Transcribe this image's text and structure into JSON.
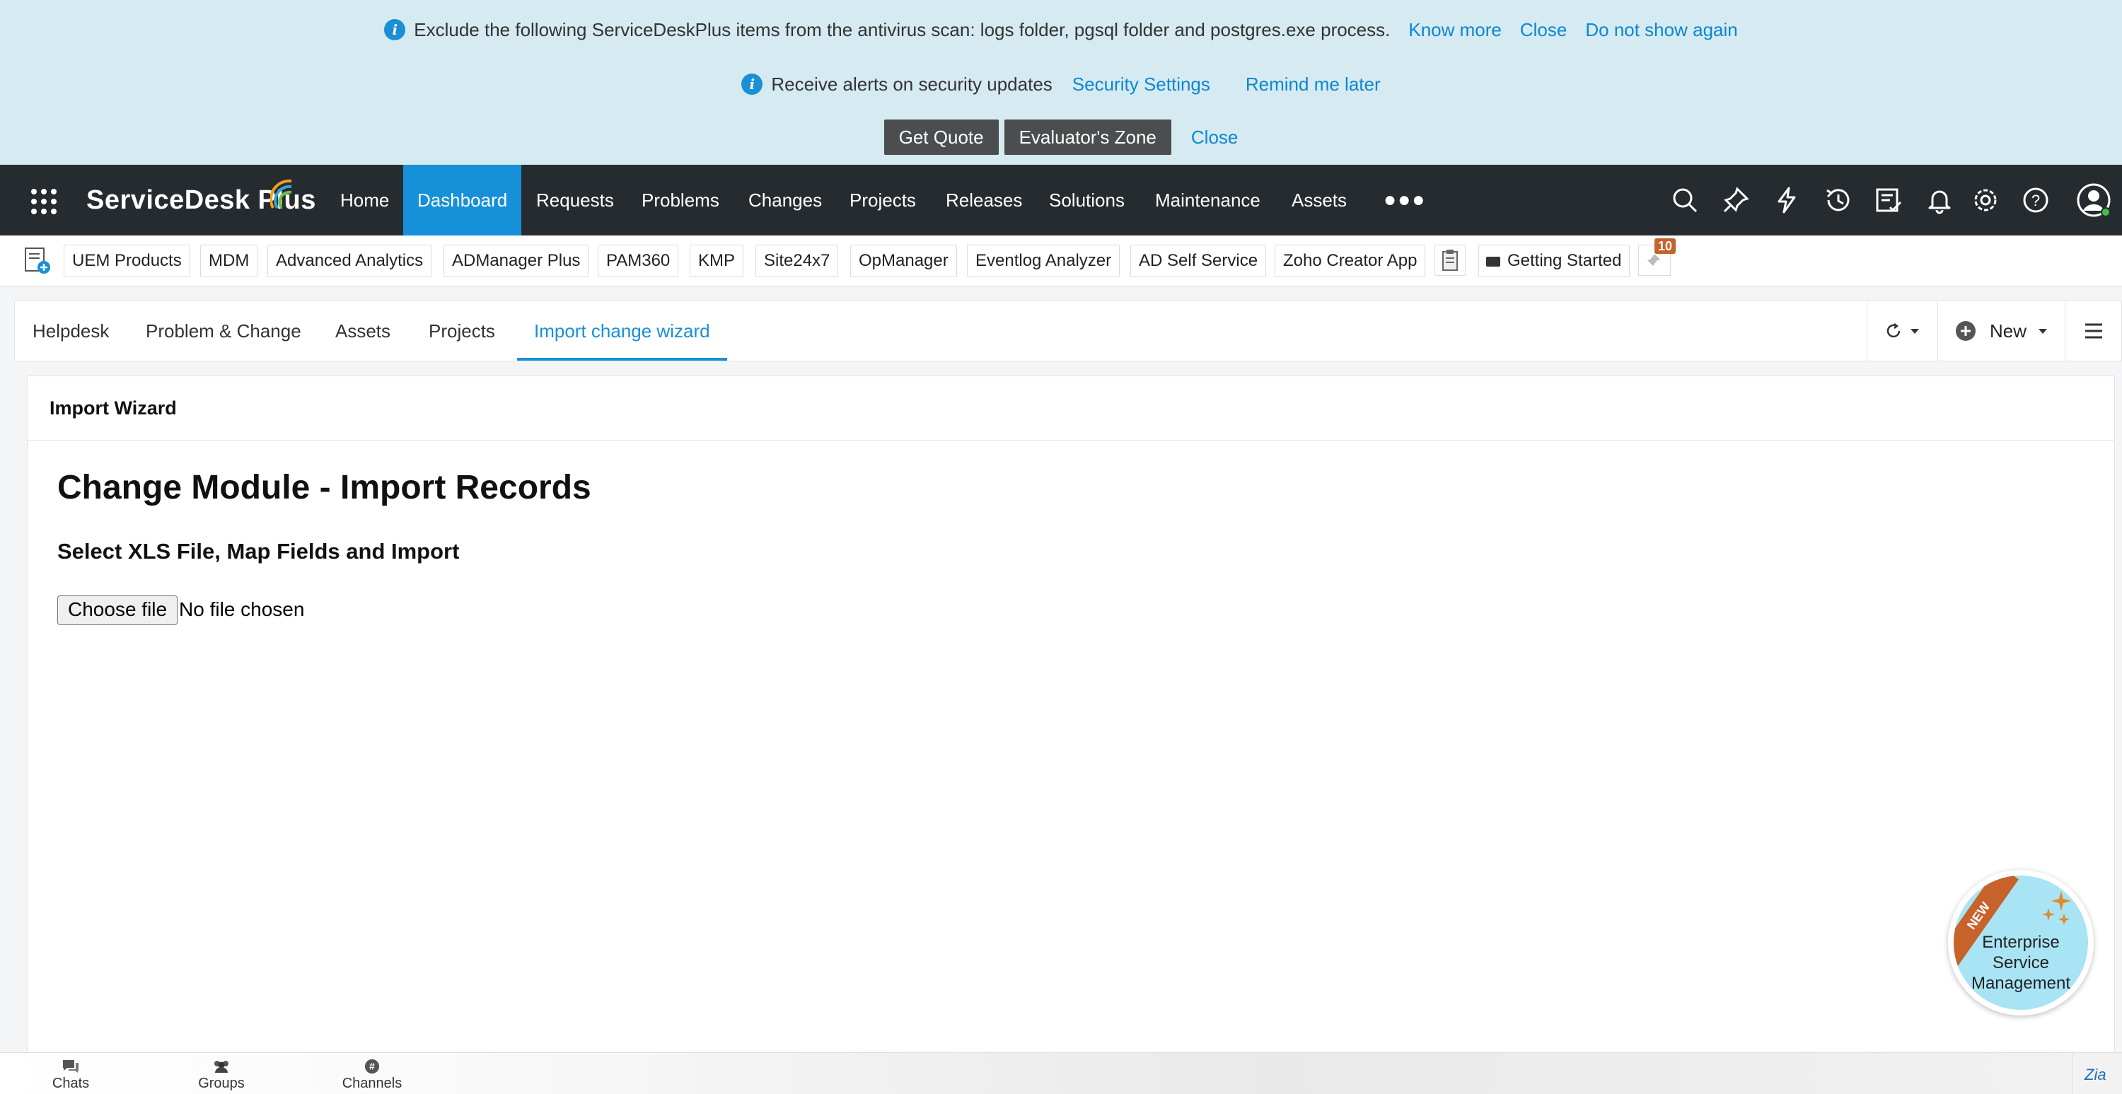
{
  "banners": {
    "antivirus": {
      "text": "Exclude the following ServiceDeskPlus items from the antivirus scan: logs folder, pgsql folder and postgres.exe process.",
      "know_more": "Know more",
      "close": "Close",
      "do_not_show": "Do not show again"
    },
    "security": {
      "text": "Receive alerts on security updates",
      "settings": "Security Settings",
      "remind": "Remind me later"
    },
    "trial": {
      "get_quote": "Get Quote",
      "evaluator": "Evaluator's Zone",
      "close": "Close"
    }
  },
  "app": {
    "logo_text": "ServiceDesk Plus",
    "nav": [
      "Home",
      "Dashboard",
      "Requests",
      "Problems",
      "Changes",
      "Projects",
      "Releases",
      "Solutions",
      "Maintenance",
      "Assets"
    ],
    "active_nav": "Dashboard",
    "icons": [
      "search-icon",
      "pin-icon",
      "lightning-icon",
      "history-icon",
      "checklist-icon",
      "bell-icon",
      "gear-icon",
      "help-icon",
      "avatar-icon"
    ]
  },
  "quick_links": {
    "items": [
      "UEM Products",
      "MDM",
      "Advanced Analytics",
      "ADManager Plus",
      "PAM360",
      "KMP",
      "Site24x7",
      "OpManager",
      "Eventlog Analyzer",
      "AD Self Service",
      "Zoho Creator App"
    ],
    "getting_started": "Getting Started",
    "badge_count": "10"
  },
  "tabs": {
    "items": [
      "Helpdesk",
      "Problem & Change",
      "Assets",
      "Projects",
      "Import change wizard"
    ],
    "active": "Import change wizard",
    "new_label": "New"
  },
  "panel": {
    "header": "Import Wizard",
    "title": "Change Module - Import Records",
    "subtitle": "Select XLS File, Map Fields and Import",
    "choose_file": "Choose file",
    "no_file": "No file chosen"
  },
  "esm_badge": {
    "ribbon": "NEW",
    "text_line1": "Enterprise",
    "text_line2": "Service",
    "text_line3": "Management"
  },
  "chat_bar": {
    "items": [
      "Chats",
      "Groups",
      "Channels"
    ]
  },
  "colors": {
    "banner_bg": "#d5eaf1",
    "nav_bg": "#262b2f",
    "accent": "#1690d8",
    "link": "#0d87cf"
  }
}
